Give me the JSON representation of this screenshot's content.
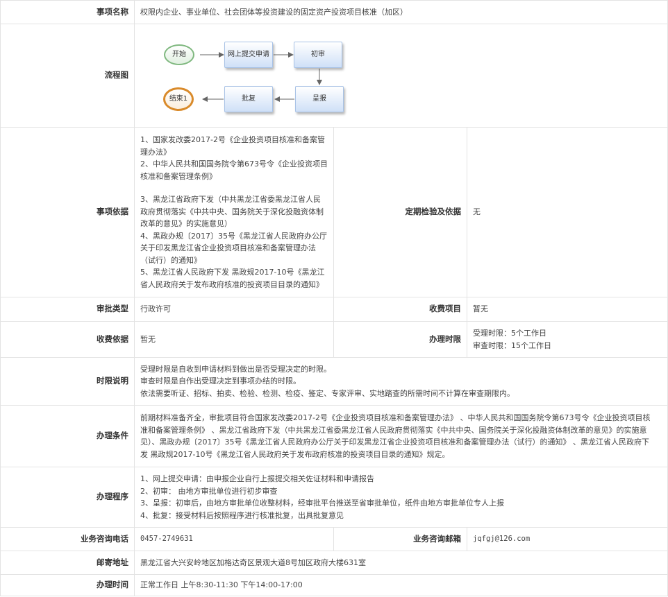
{
  "rows": {
    "item_name": {
      "label": "事项名称",
      "value": "权限内企业、事业单位、社会团体等投资建设的固定资产投资项目核准（加区）"
    },
    "flowchart": {
      "label": "流程图",
      "nodes": {
        "start": "开始",
        "submit": "网上提交申请",
        "first_review": "初审",
        "report": "呈报",
        "approve": "批复",
        "end": "结束1"
      }
    },
    "basis": {
      "label": "事项依据",
      "lines": [
        "1、国家发改委2017-2号《企业投资项目核准和备案管",
        "理办法》",
        "2、中华人民共和国国务院令第673号令《企业投资项目",
        "核准和备案管理条例》",
        "3、黑龙江省政府下发（中共黑龙江省委黑龙江省人民",
        "政府贯彻落实《中共中央、国务院关于深化投融资体制",
        "改革的意见》的实施意见）",
        "4、黑政办规〔2017〕35号《黑龙江省人民政府办公厅",
        "关于印发黑龙江省企业投资项目核准和备案管理办法",
        "（试行）的通知》",
        "5、黑龙江省人民政府下发 黑政规2017-10号《黑龙江",
        "省人民政府关于发布政府核准的投资项目目录的通知》"
      ],
      "inspection_label": "定期检验及依据",
      "inspection_value": "无"
    },
    "approval_type": {
      "label": "审批类型",
      "value": "行政许可",
      "fee_item_label": "收费项目",
      "fee_item_value": "暂无"
    },
    "fee_basis": {
      "label": "收费依据",
      "value": "暂无",
      "time_limit_label": "办理时限",
      "time_limit_lines": [
        "受理时限：5个工作日",
        "审查时限：15个工作日"
      ]
    },
    "time_note": {
      "label": "时限说明",
      "lines": [
        "受理时限是自收到申请材料到做出是否受理决定的时限。",
        "审查时限是自作出受理决定到事项办结的时限。",
        "依法需要听证、招标、拍卖、检验、检测、检疫、鉴定、专家评审、实地踏查的所需时间不计算在审查期限内。"
      ]
    },
    "conditions": {
      "label": "办理条件",
      "lines": [
        "前期材料准备齐全，审批项目符合国家发改委2017-2号《企业投资项目核准和备案管理办法》 、中华人民共和国国务院令第673号令《企业投资项目核",
        "准和备案管理条例》 、黑龙江省政府下发（中共黑龙江省委黑龙江省人民政府贯彻落实《中共中央、国务院关于深化投融资体制改革的意见》的实施意",
        "见）、黑政办规〔2017〕35号《黑龙江省人民政府办公厅关于印发黑龙江省企业投资项目核准和备案管理办法（试行）的通知》 、黑龙江省人民政府下",
        "发 黑政规2017-10号《黑龙江省人民政府关于发布政府核准的投资项目目录的通知》规定。"
      ]
    },
    "procedure": {
      "label": "办理程序",
      "lines": [
        "1、网上提交申请：由申报企业自行上报提交相关佐证材料和申请报告",
        "2、初审： 由地方审批单位进行初步审查",
        "3、呈报：初审后，由地方审批单位收整材料，经审批平台推送至省审批单位，纸件由地方审批单位专人上报",
        "4、批复：接受材料后按照程序进行核准批复，出具批复意见"
      ]
    },
    "contact": {
      "phone_label": "业务咨询电话",
      "phone_value": "0457-2749631",
      "email_label": "业务咨询邮箱",
      "email_value": "jqfgj@126.com"
    },
    "address": {
      "label": "邮寄地址",
      "value": "黑龙江省大兴安岭地区加格达奇区景观大道8号加区政府大楼631室"
    },
    "hours": {
      "label": "办理时间",
      "value": "正常工作日 上午8:30-11:30 下午14:00-17:00"
    }
  },
  "colors": {
    "border": "#e3e3e3",
    "box_fill": "#cfe0f7",
    "start_oval": "#7fb87f",
    "end_oval": "#d98a2a"
  }
}
